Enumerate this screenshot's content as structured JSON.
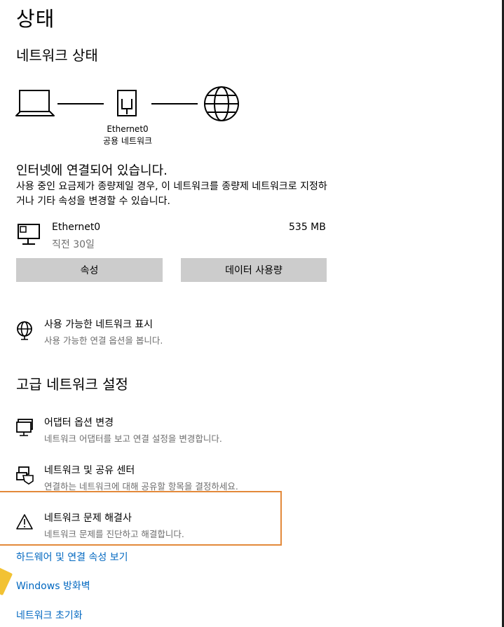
{
  "page": {
    "title": "상태",
    "network_status_heading": "네트워크 상태"
  },
  "diagram": {
    "adapter_name": "Ethernet0",
    "network_type": "공용 네트워크"
  },
  "connection": {
    "title": "인터넷에 연결되어 있습니다.",
    "description": "사용 중인 요금제가 종량제일 경우, 이 네트워크를 종량제 네트워크로 지정하거나 기타 속성을 변경할 수 있습니다."
  },
  "adapter": {
    "name": "Ethernet0",
    "duration": "직전 30일",
    "usage": "535 MB"
  },
  "buttons": {
    "properties": "속성",
    "data_usage": "데이터 사용량"
  },
  "available_networks": {
    "title": "사용 가능한 네트워크 표시",
    "subtitle": "사용 가능한 연결 옵션을 봅니다."
  },
  "advanced": {
    "heading": "고급 네트워크 설정",
    "items": [
      {
        "title": "어댑터 옵션 변경",
        "subtitle": "네트워크 어댑터를 보고 연결 설정을 변경합니다.",
        "icon": "adapter-icon"
      },
      {
        "title": "네트워크 및 공유 센터",
        "subtitle": "연결하는 네트워크에 대해 공유할 항목을 결정하세요.",
        "icon": "sharing-icon"
      },
      {
        "title": "네트워크 문제 해결사",
        "subtitle": "네트워크 문제를 진단하고 해결합니다.",
        "icon": "warning-icon"
      }
    ]
  },
  "links": [
    "하드웨어 및 연결 속성 보기",
    "Windows 방화벽",
    "네트워크 초기화"
  ],
  "colors": {
    "link": "#0067c0",
    "button_bg": "#cccccc",
    "highlight_border": "#e3893a",
    "secondary_text": "#6d6d6d"
  }
}
